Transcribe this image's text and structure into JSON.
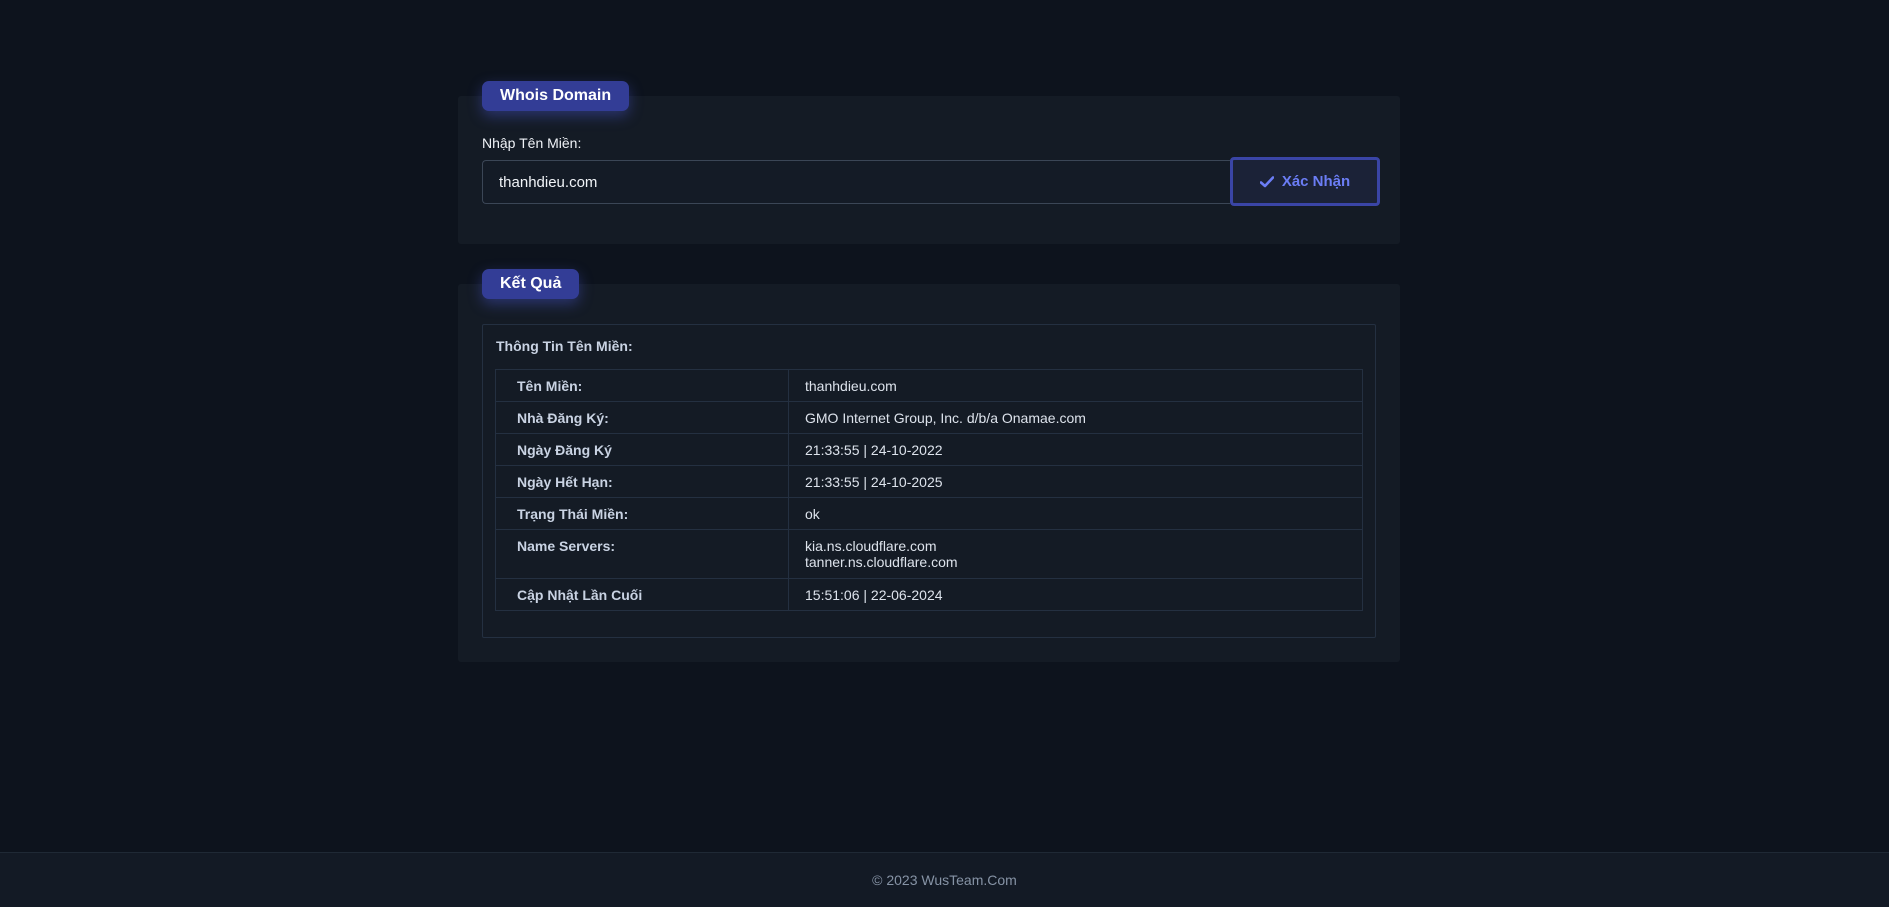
{
  "whois_card": {
    "title": "Whois Domain",
    "input_label": "Nhập Tên Miền:",
    "input_value": "thanhdieu.com",
    "submit_label": "Xác Nhận",
    "submit_icon": "check-icon"
  },
  "result_card": {
    "title": "Kết Quả",
    "heading": "Thông Tin Tên Miền:",
    "rows": [
      {
        "key": "Tên Miền:",
        "value": "thanhdieu.com"
      },
      {
        "key": "Nhà Đăng Ký:",
        "value": "GMO Internet Group, Inc. d/b/a Onamae.com"
      },
      {
        "key": "Ngày Đăng Ký",
        "value": "21:33:55 | 24-10-2022"
      },
      {
        "key": "Ngày Hết Hạn:",
        "value": "21:33:55 | 24-10-2025"
      },
      {
        "key": "Trạng Thái Miền:",
        "value": "ok"
      },
      {
        "key": "Name Servers:",
        "values": [
          "kia.ns.cloudflare.com",
          "tanner.ns.cloudflare.com"
        ]
      },
      {
        "key": "Cập Nhật Lần Cuối",
        "value": "15:51:06 | 22-06-2024"
      }
    ]
  },
  "footer": {
    "text": "© 2023 WusTeam.Com"
  },
  "colors": {
    "background": "#0d131d",
    "card": "#141b25",
    "badge": "#333d96",
    "accent": "#6b7df5"
  }
}
